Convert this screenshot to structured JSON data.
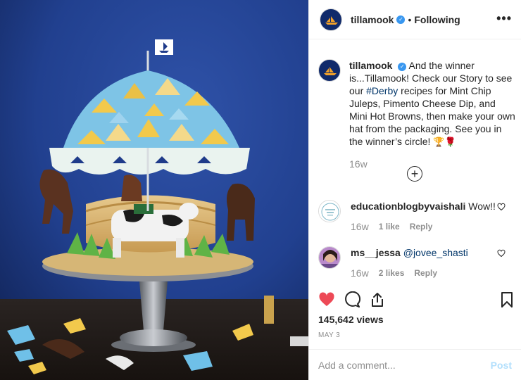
{
  "post": {
    "username": "tillamook",
    "follow_status": "Following",
    "more_icon": "more-options-icon"
  },
  "caption": {
    "username": "tillamook",
    "text_before_tag": "And the winner is...Tillamook! Check our Story to see our ",
    "hashtag": "#Derby",
    "text_after_tag": " recipes for Mint Chip Juleps, Pimento Cheese Dip, and Mini Hot Browns, then make your own hat from the packaging. See you in the winner’s circle!",
    "emojis": "🏆🌹",
    "time": "16w"
  },
  "comments": [
    {
      "username": "educationblogbyvaishali",
      "text": "Wow!!",
      "time": "16w",
      "likes": "1 like",
      "reply": "Reply"
    },
    {
      "username": "ms__jessa",
      "text": "@jovee_shasti",
      "time": "16w",
      "likes": "2 likes",
      "reply": "Reply"
    }
  ],
  "stats": {
    "views": "145,642 views",
    "date": "MAY 3"
  },
  "add_comment": {
    "placeholder": "Add a comment...",
    "post_label": "Post"
  },
  "colors": {
    "link": "#003569",
    "verified": "#3897f0",
    "liked": "#ed4956",
    "post_disabled": "#b2dffc",
    "media_bg": "#1f3b8a"
  }
}
